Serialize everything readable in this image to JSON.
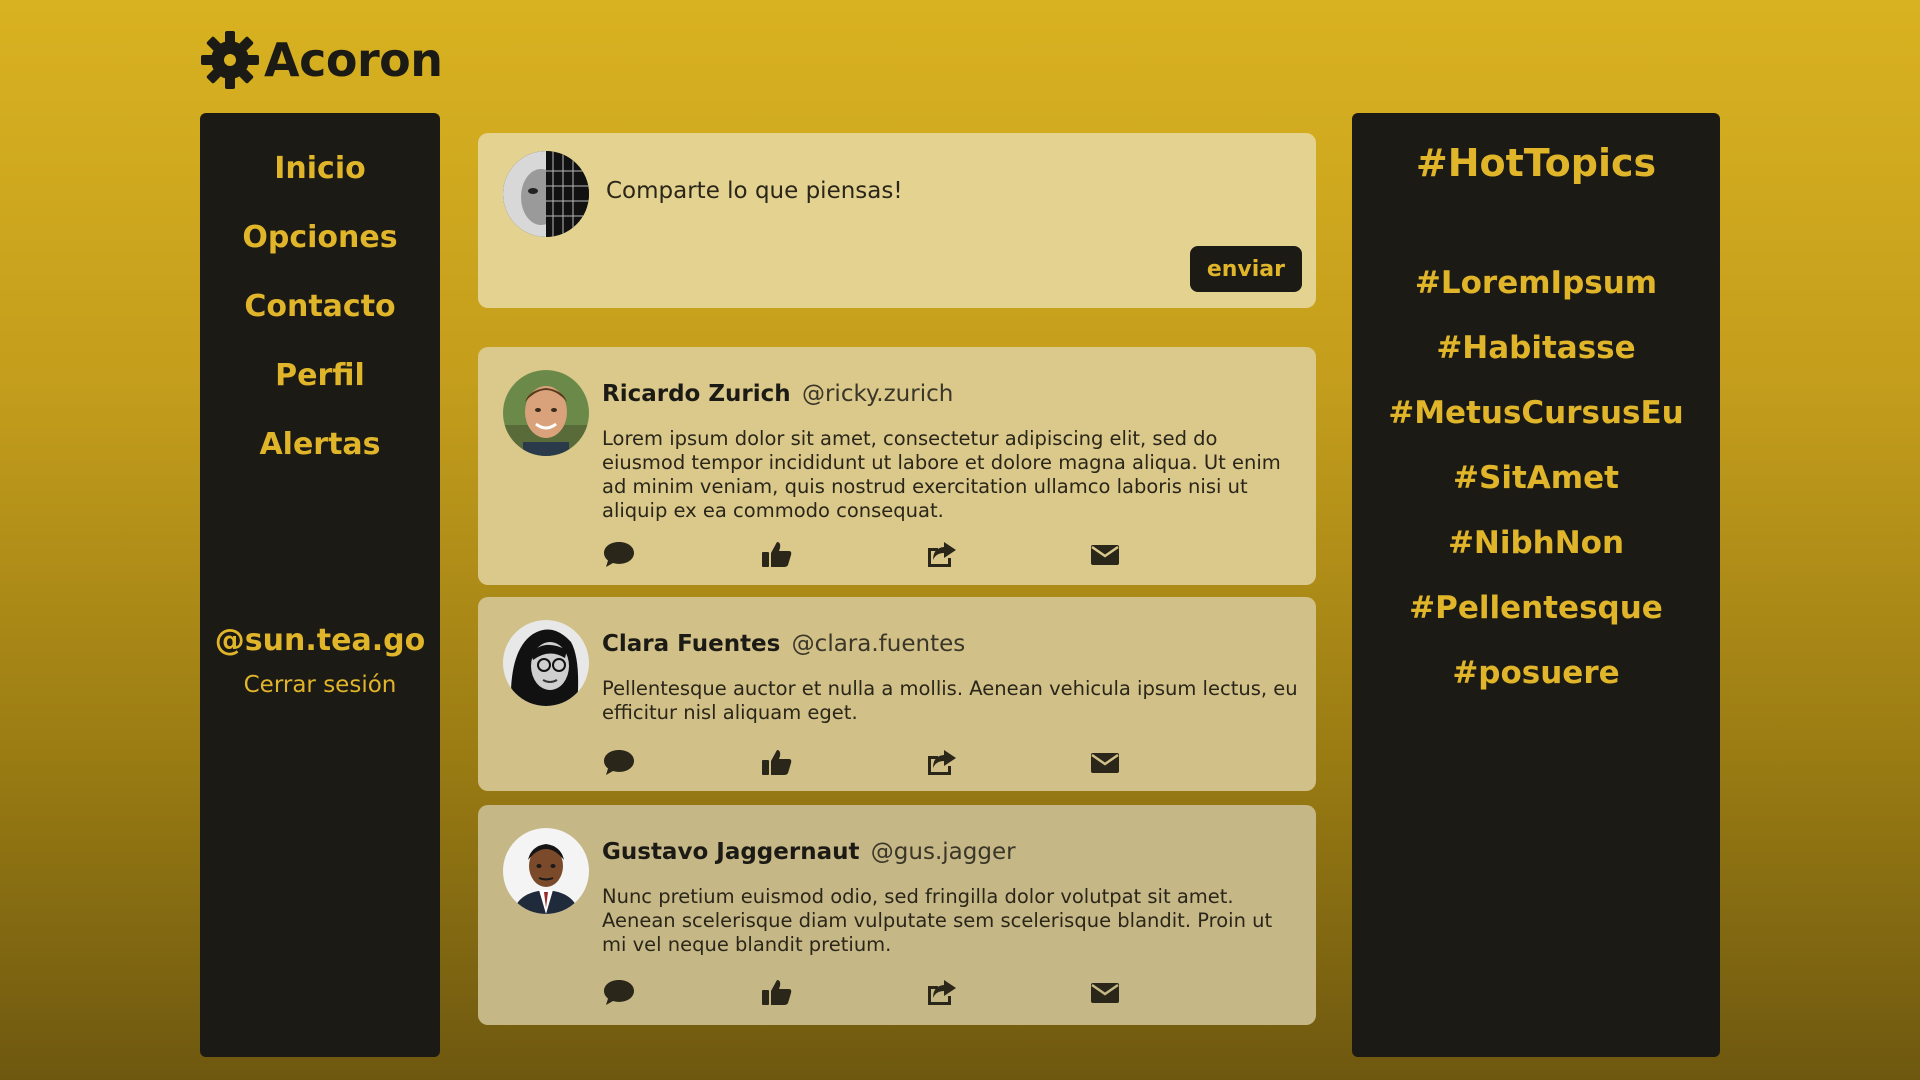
{
  "brand": {
    "name": "Acoron",
    "icon": "gear-icon"
  },
  "nav": {
    "items": [
      {
        "label": "Inicio"
      },
      {
        "label": "Opciones"
      },
      {
        "label": "Contacto"
      },
      {
        "label": "Perfil"
      },
      {
        "label": "Alertas"
      }
    ]
  },
  "user": {
    "handle": "@sun.tea.go",
    "logout_label": "Cerrar sesión"
  },
  "composer": {
    "placeholder": "Comparte lo que piensas!",
    "send_label": "enviar"
  },
  "posts": [
    {
      "author": "Ricardo Zurich",
      "handle": "@ricky.zurich",
      "text": "Lorem ipsum dolor sit amet, consectetur adipiscing elit, sed do eiusmod tempor incididunt ut labore et dolore magna aliqua. Ut enim ad minim veniam, quis nostrud exercitation ullamco laboris nisi ut aliquip ex ea commodo consequat."
    },
    {
      "author": "Clara Fuentes",
      "handle": "@clara.fuentes",
      "text": "Pellentesque auctor et nulla a mollis. Aenean vehicula ipsum lectus, eu efficitur nisl aliquam eget."
    },
    {
      "author": "Gustavo Jaggernaut",
      "handle": "@gus.jagger",
      "text": "Nunc pretium euismod odio, sed fringilla dolor volutpat sit amet. Aenean scelerisque diam vulputate sem scelerisque blandit. Proin ut mi vel neque blandit pretium."
    }
  ],
  "hot_topics": {
    "title": "#HotTopics",
    "items": [
      "#LoremIpsum",
      "#Habitasse",
      "#MetusCursusEu",
      "#SitAmet",
      "#NibhNon",
      "#Pellentesque",
      "#posuere"
    ]
  },
  "post_actions": [
    "comment-icon",
    "thumbs-up-icon",
    "share-icon",
    "envelope-icon"
  ],
  "colors": {
    "accent": "#e0b52a",
    "panel": "#1c1a15",
    "card": "#e4d291"
  }
}
